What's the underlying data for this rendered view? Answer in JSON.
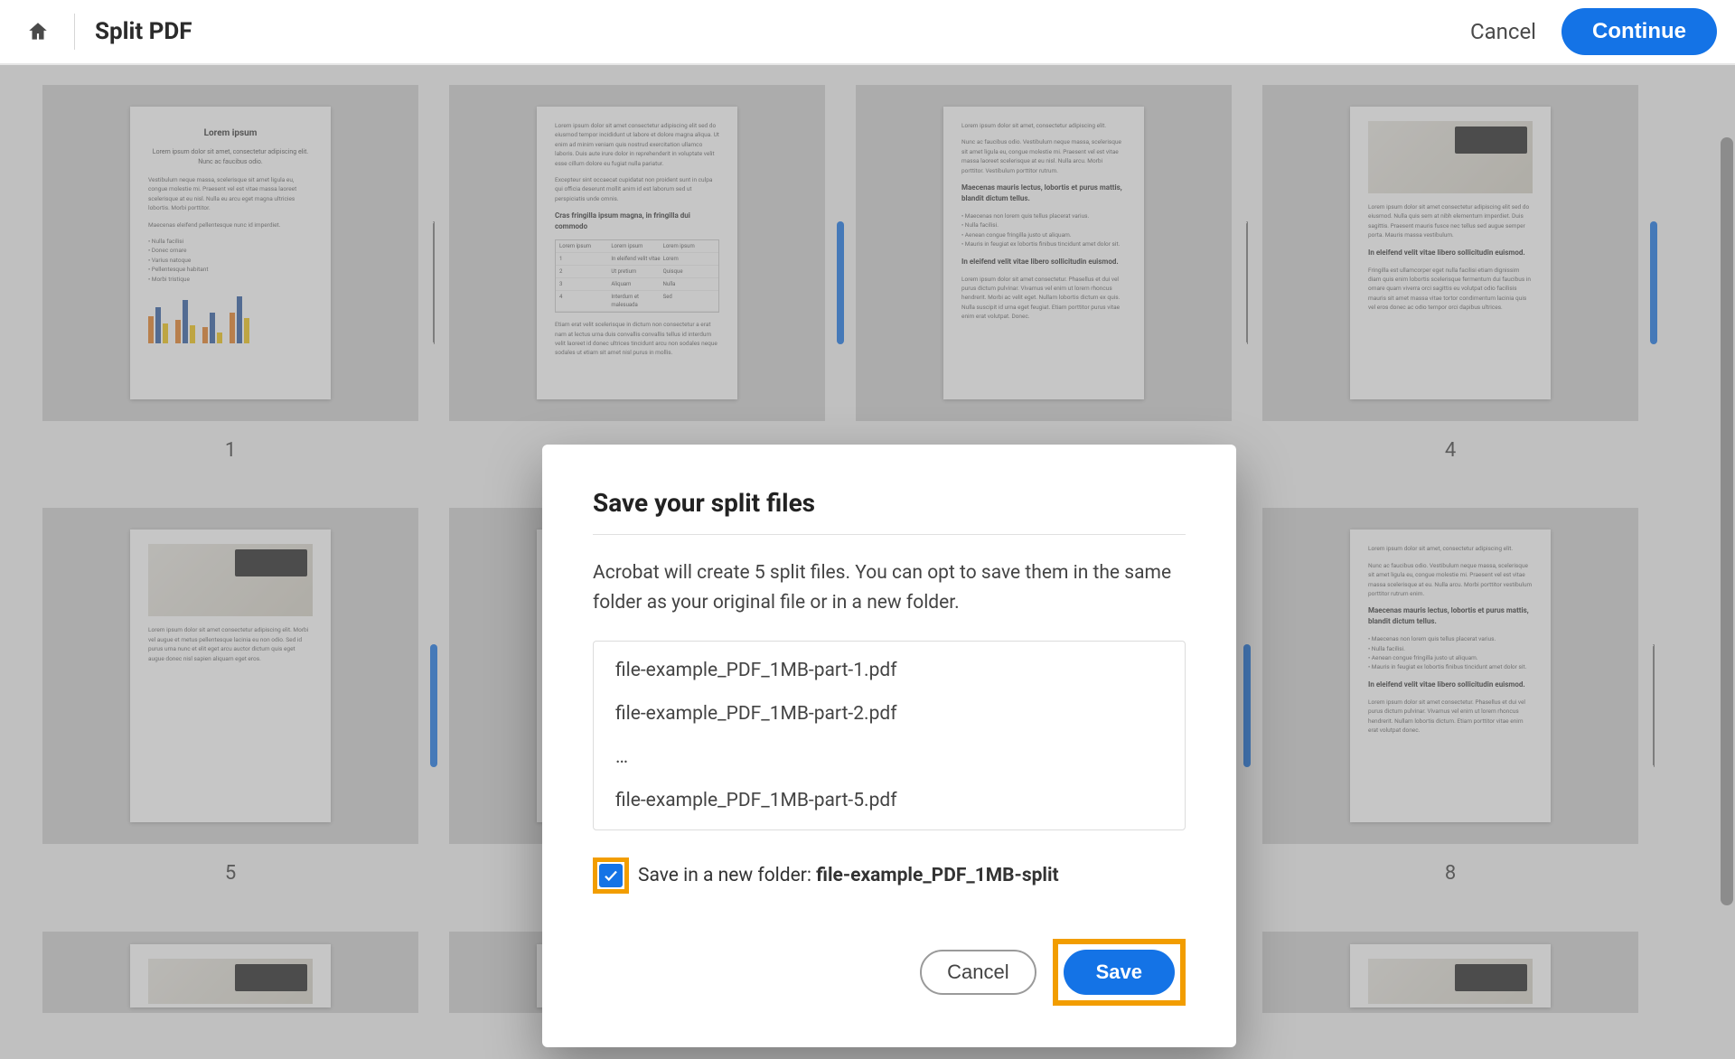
{
  "header": {
    "title": "Split PDF",
    "cancel": "Cancel",
    "continue": "Continue"
  },
  "pages": {
    "p1": "1",
    "p4": "4",
    "p5": "5",
    "p8": "8"
  },
  "modal": {
    "title": "Save your split files",
    "description": "Acrobat will create 5 split files. You can opt to save them in the same folder as your original file or in a new folder.",
    "files": {
      "f1": "file-example_PDF_1MB-part-1.pdf",
      "f2": "file-example_PDF_1MB-part-2.pdf",
      "ellipsis": "…",
      "f5": "file-example_PDF_1MB-part-5.pdf"
    },
    "folder_label_prefix": "Save in a new folder: ",
    "folder_name": "file-example_PDF_1MB-split",
    "cancel": "Cancel",
    "save": "Save"
  }
}
